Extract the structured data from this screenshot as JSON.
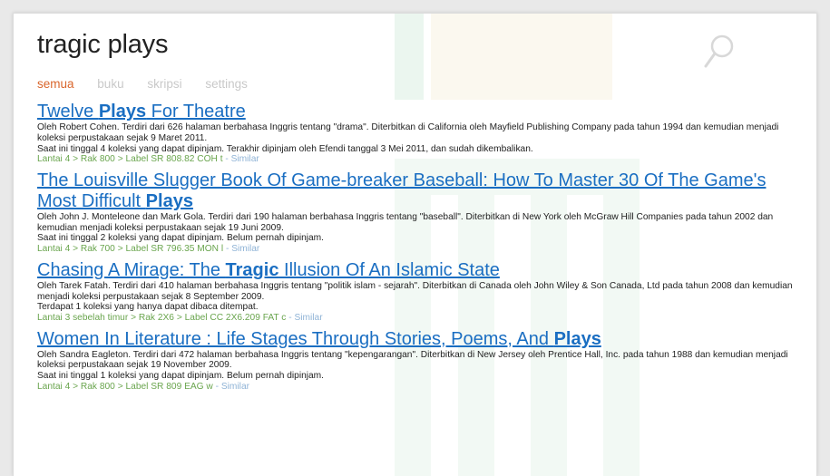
{
  "search": {
    "query": "tragic plays"
  },
  "tabs": [
    {
      "label": "semua",
      "active": true
    },
    {
      "label": "buku",
      "active": false
    },
    {
      "label": "skripsi",
      "active": false
    },
    {
      "label": "settings",
      "active": false
    }
  ],
  "results": [
    {
      "title_parts": [
        {
          "text": "Twelve ",
          "bold": false
        },
        {
          "text": "Plays",
          "bold": true
        },
        {
          "text": " For Theatre",
          "bold": false
        }
      ],
      "description": "Oleh Robert Cohen. Terdiri dari 626 halaman berbahasa Inggris tentang \"drama\". Diterbitkan di California oleh Mayfield Publishing Company pada tahun 1994 dan kemudian menjadi koleksi perpustakaan sejak 9 Maret 2011.",
      "availability": "Saat ini tinggal 4 koleksi yang dapat dipinjam. Terakhir dipinjam oleh Efendi tanggal 3 Mei 2011, dan sudah dikembalikan.",
      "location": [
        "Lantai 4",
        "Rak 800",
        "Label SR 808.82 COH t"
      ],
      "similar_label": "Similar"
    },
    {
      "title_parts": [
        {
          "text": "The Louisville Slugger Book Of Game-breaker Baseball: How To Master 30 Of The Game's Most Difficult ",
          "bold": false
        },
        {
          "text": "Plays",
          "bold": true
        }
      ],
      "description": "Oleh John J. Monteleone dan Mark Gola. Terdiri dari 190 halaman berbahasa Inggris tentang \"baseball\". Diterbitkan di New York oleh McGraw Hill Companies pada tahun 2002 dan kemudian menjadi koleksi perpustakaan sejak 19 Juni 2009.",
      "availability": "Saat ini tinggal 2 koleksi yang dapat dipinjam. Belum pernah dipinjam.",
      "location": [
        "Lantai 4",
        "Rak 700",
        "Label SR 796.35 MON l"
      ],
      "similar_label": "Similar"
    },
    {
      "title_parts": [
        {
          "text": "Chasing A Mirage: The ",
          "bold": false
        },
        {
          "text": "Tragic",
          "bold": true
        },
        {
          "text": " Illusion Of An Islamic State",
          "bold": false
        }
      ],
      "description": "Oleh Tarek Fatah. Terdiri dari 410 halaman berbahasa Inggris tentang \"politik islam - sejarah\". Diterbitkan di Canada oleh John Wiley & Son Canada, Ltd pada tahun 2008 dan kemudian menjadi koleksi perpustakaan sejak 8 September 2009.",
      "availability": "Terdapat 1 koleksi yang hanya dapat dibaca ditempat.",
      "location": [
        "Lantai 3 sebelah timur",
        "Rak 2X6",
        "Label CC 2X6.209 FAT c"
      ],
      "similar_label": "Similar"
    },
    {
      "title_parts": [
        {
          "text": "Women In Literature : Life Stages Through Stories, Poems, And ",
          "bold": false
        },
        {
          "text": "Plays",
          "bold": true
        }
      ],
      "description": "Oleh Sandra Eagleton. Terdiri dari 472 halaman berbahasa Inggris tentang \"kepengarangan\". Diterbitkan di New Jersey oleh Prentice Hall, Inc. pada tahun 1988 dan kemudian menjadi koleksi perpustakaan sejak 19 November 2009.",
      "availability": "Saat ini tinggal 1 koleksi yang dapat dipinjam. Belum pernah dipinjam.",
      "location": [
        "Lantai 4",
        "Rak 800",
        "Label SR 809 EAG w"
      ],
      "similar_label": "Similar"
    }
  ],
  "separators": {
    "location": ">",
    "similar": "-"
  },
  "colors": {
    "link": "#1a6ec2",
    "active_tab": "#d9652b",
    "inactive_tab": "#c9c9c9",
    "location": "#6aa54e",
    "similar": "#8fb3d6"
  }
}
